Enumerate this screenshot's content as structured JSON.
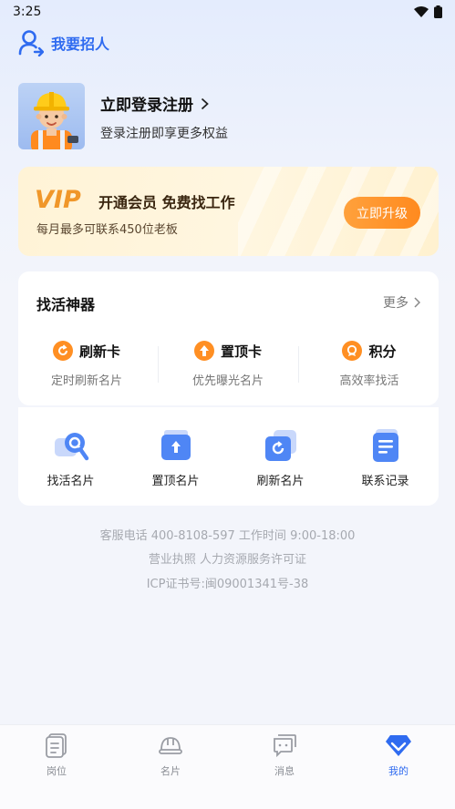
{
  "status_bar": {
    "time": "3:25"
  },
  "header": {
    "label": "我要招人"
  },
  "profile": {
    "title": "立即登录注册",
    "subtitle": "登录注册即享更多权益"
  },
  "vip": {
    "logo_text": "VIP",
    "title": "开通会员 免费找工作",
    "subtitle": "每月最多可联系450位老板",
    "button": "立即升级"
  },
  "tools": {
    "title": "找活神器",
    "more": "更多",
    "items": [
      {
        "name": "刷新卡",
        "desc": "定时刷新名片",
        "icon": "refresh-icon"
      },
      {
        "name": "置顶卡",
        "desc": "优先曝光名片",
        "icon": "arrow-up-icon"
      },
      {
        "name": "积分",
        "desc": "高效率找活",
        "icon": "points-icon"
      }
    ]
  },
  "cards": {
    "items": [
      {
        "label": "找活名片",
        "icon": "search-card-icon"
      },
      {
        "label": "置顶名片",
        "icon": "top-card-icon"
      },
      {
        "label": "刷新名片",
        "icon": "refresh-card-icon"
      },
      {
        "label": "联系记录",
        "icon": "record-icon"
      }
    ]
  },
  "info": {
    "line1": "客服电话 400-8108-597 工作时间 9:00-18:00",
    "line2": "营业执照  人力资源服务许可证",
    "line3": "ICP证书号:闽09001341号-38"
  },
  "tabbar": {
    "active_index": 3,
    "items": [
      {
        "label": "岗位",
        "icon": "document-icon"
      },
      {
        "label": "名片",
        "icon": "helmet-icon"
      },
      {
        "label": "消息",
        "icon": "message-icon"
      },
      {
        "label": "我的",
        "icon": "profile-diamond-icon"
      }
    ]
  },
  "colors": {
    "accent": "#2f6bf0",
    "orange": "#ff8f23",
    "vip_bg": "#fff3d6"
  }
}
